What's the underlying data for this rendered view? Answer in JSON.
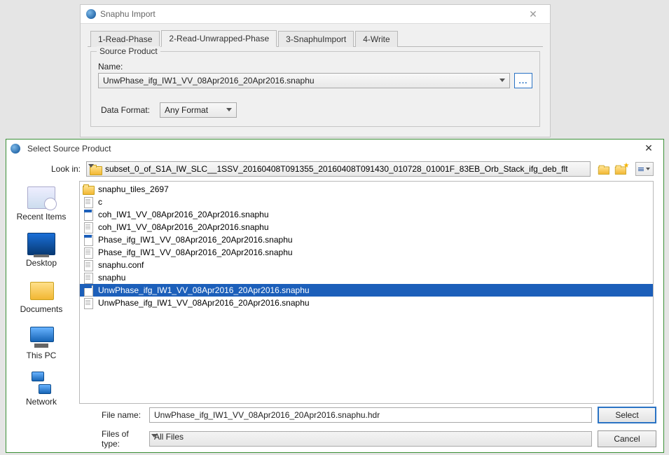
{
  "snaphu": {
    "title": "Snaphu Import",
    "tabs": [
      "1-Read-Phase",
      "2-Read-Unwrapped-Phase",
      "3-SnaphuImport",
      "4-Write"
    ],
    "active_tab": 1,
    "group_title": "Source Product",
    "name_label": "Name:",
    "name_value": "UnwPhase_ifg_IW1_VV_08Apr2016_20Apr2016.snaphu",
    "browse_label": "...",
    "format_label": "Data Format:",
    "format_value": "Any Format"
  },
  "chooser": {
    "title": "Select Source Product",
    "lookin_label": "Look in:",
    "lookin_value": "subset_0_of_S1A_IW_SLC__1SSV_20160408T091355_20160408T091430_010728_01001F_83EB_Orb_Stack_ifg_deb_flt",
    "places": [
      {
        "label": "Recent Items",
        "icon": "recent"
      },
      {
        "label": "Desktop",
        "icon": "desktop"
      },
      {
        "label": "Documents",
        "icon": "docs"
      },
      {
        "label": "This PC",
        "icon": "pc"
      },
      {
        "label": "Network",
        "icon": "net"
      }
    ],
    "files": [
      {
        "name": "snaphu_tiles_2697",
        "type": "folder"
      },
      {
        "name": "c",
        "type": "file"
      },
      {
        "name": "coh_IW1_VV_08Apr2016_20Apr2016.snaphu",
        "type": "hdr"
      },
      {
        "name": "coh_IW1_VV_08Apr2016_20Apr2016.snaphu",
        "type": "file"
      },
      {
        "name": "Phase_ifg_IW1_VV_08Apr2016_20Apr2016.snaphu",
        "type": "hdr"
      },
      {
        "name": "Phase_ifg_IW1_VV_08Apr2016_20Apr2016.snaphu",
        "type": "file"
      },
      {
        "name": "snaphu.conf",
        "type": "file"
      },
      {
        "name": "snaphu",
        "type": "file"
      },
      {
        "name": "UnwPhase_ifg_IW1_VV_08Apr2016_20Apr2016.snaphu",
        "type": "hdr",
        "selected": true
      },
      {
        "name": "UnwPhase_ifg_IW1_VV_08Apr2016_20Apr2016.snaphu",
        "type": "file"
      }
    ],
    "filename_label": "File name:",
    "filename_value": "UnwPhase_ifg_IW1_VV_08Apr2016_20Apr2016.snaphu.hdr",
    "filetype_label": "Files of type:",
    "filetype_value": "All Files",
    "select_label": "Select",
    "cancel_label": "Cancel"
  }
}
